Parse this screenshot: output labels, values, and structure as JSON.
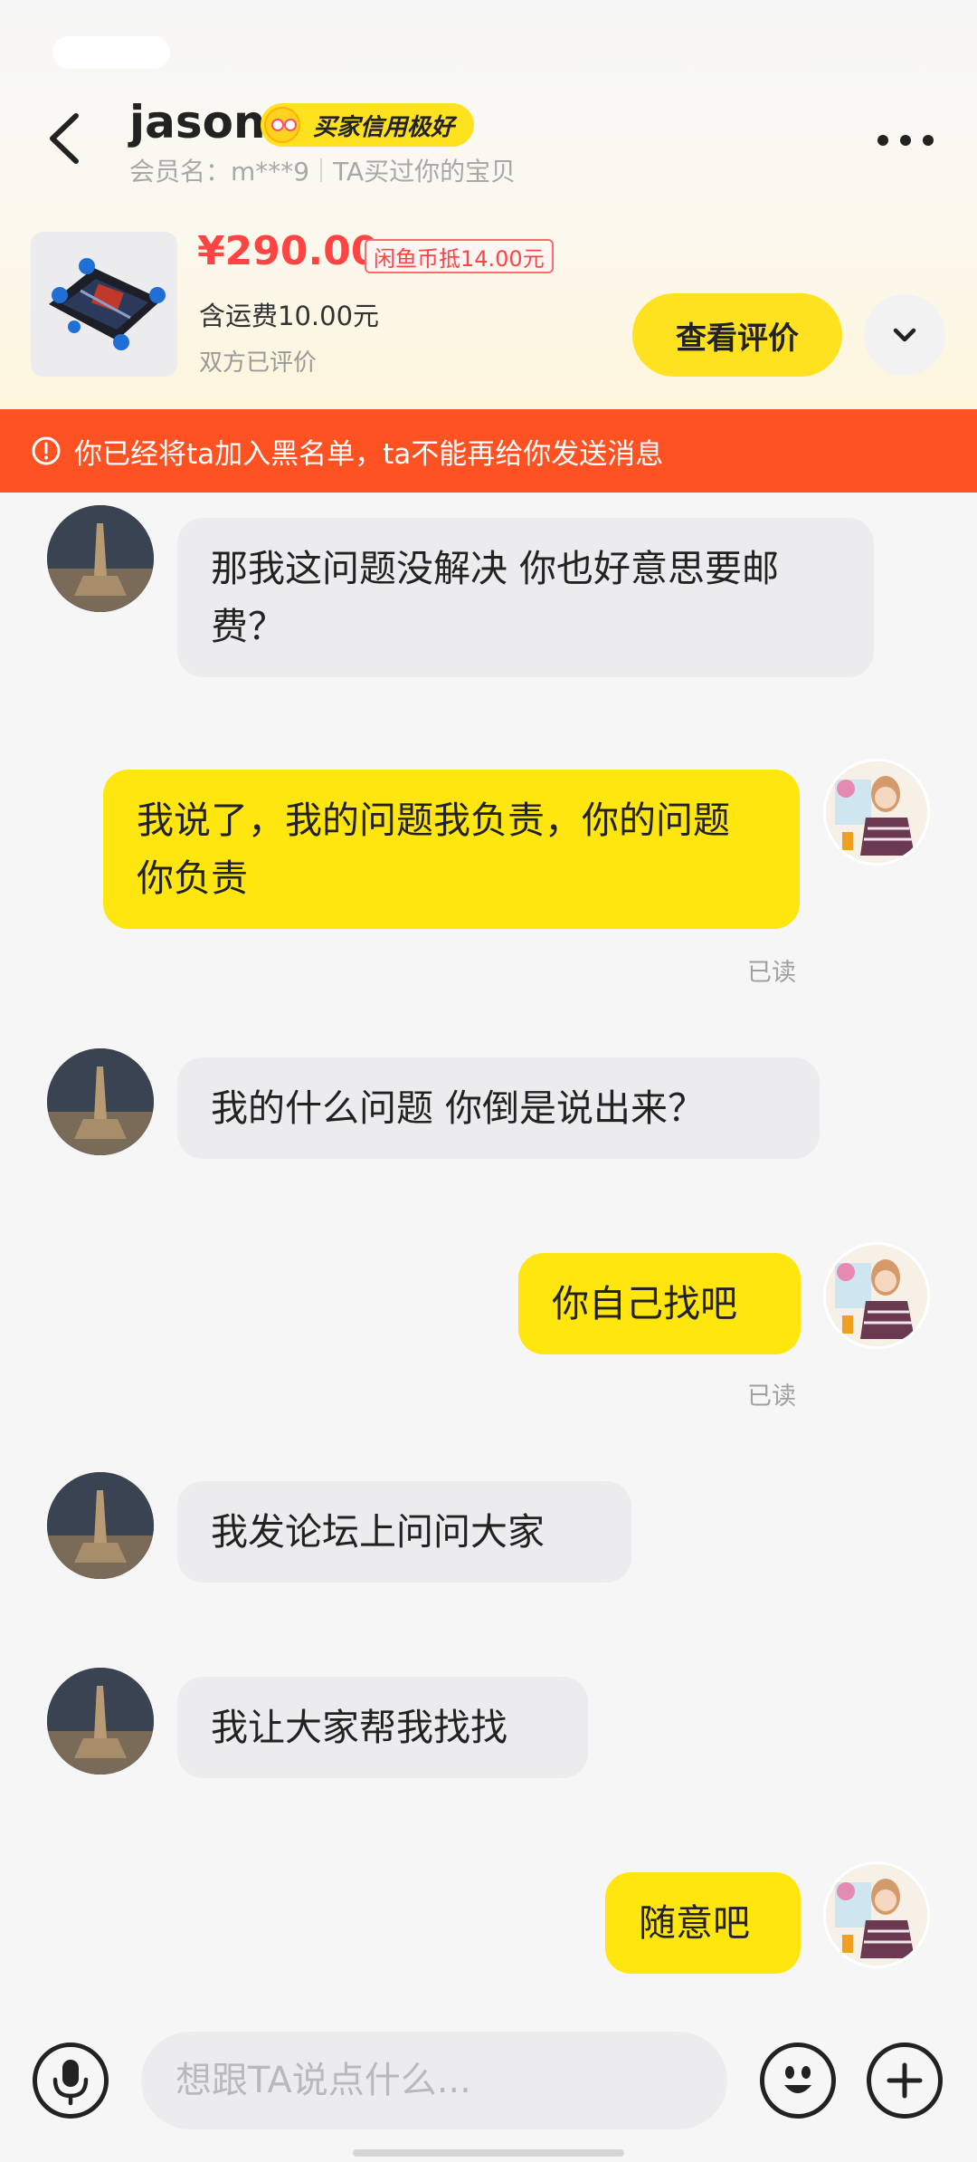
{
  "header": {
    "nickname": "jason",
    "credit_badge": "买家信用极好",
    "member_name": "会员名：m***9",
    "relation": "TA买过你的宝贝"
  },
  "product": {
    "price": "¥290.00",
    "coin_discount": "闲鱼币抵14.00元",
    "shipping": "含运费10.00元",
    "review_state": "双方已评价",
    "review_button": "查看评价"
  },
  "banner": {
    "text": "你已经将ta加入黑名单，ta不能再给你发送消息"
  },
  "messages": [
    {
      "side": "in",
      "text": "那我这问题没解决 你也好意思要邮费？"
    },
    {
      "side": "out",
      "text": "我说了，我的问题我负责，你的问题你负责",
      "status": "已读"
    },
    {
      "side": "in",
      "text": "我的什么问题 你倒是说出来？"
    },
    {
      "side": "out",
      "text": "你自己找吧",
      "status": "已读"
    },
    {
      "side": "in",
      "text": "我发论坛上问问大家"
    },
    {
      "side": "in",
      "text": "我让大家帮我找找"
    },
    {
      "side": "out",
      "text": "随意吧"
    }
  ],
  "input": {
    "placeholder": "想跟TA说点什么..."
  },
  "colors": {
    "accent_yellow": "#ffe60f",
    "banner_red": "#ff5223",
    "price_red": "#ff4444"
  },
  "icons": [
    "back-arrow-icon",
    "more-dots-icon",
    "chevron-down-icon",
    "alert-circle-icon",
    "microphone-icon",
    "emoji-icon",
    "plus-icon"
  ]
}
